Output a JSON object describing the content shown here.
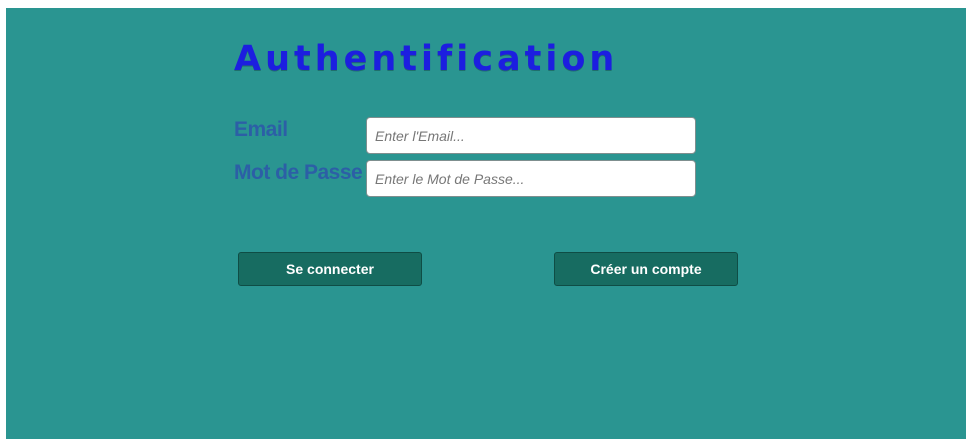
{
  "theme": {
    "background": "#2a9591",
    "title_color": "#1c1ee0",
    "label_color": "#2c5fa6",
    "button_color": "#176c61",
    "button_text_color": "#ffffff"
  },
  "page": {
    "title": "Authentification"
  },
  "form": {
    "email": {
      "label": "Email",
      "placeholder": "Enter l'Email...",
      "value": ""
    },
    "password": {
      "label": "Mot de Passe",
      "placeholder": "Enter le Mot de Passe...",
      "value": ""
    }
  },
  "actions": {
    "login_label": "Se connecter",
    "create_account_label": "Créer un compte"
  }
}
